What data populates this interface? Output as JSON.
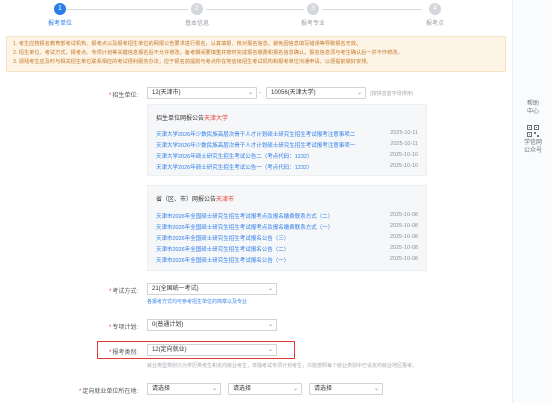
{
  "steps": [
    {
      "num": "1",
      "label": "报考单位",
      "active": true
    },
    {
      "num": "2",
      "label": "基本信息",
      "active": false
    },
    {
      "num": "3",
      "label": "报考专业",
      "active": false
    },
    {
      "num": "4",
      "label": "报考点",
      "active": false
    }
  ],
  "notice": [
    "1. 考生应按报名教育部考试机构、报考点以及报考招生单位的网报公告要求进行报名，认真填报、核对报名信息，避免因信息填写错误等导致报名无效。",
    "2. 招生单位、考试方式、报考点、专项计划等关键信息报名后不允许修改，备考期间要慎重并按时完成报名缴费和报名信息确认。报名信息须与考生确认后一并不作修改。",
    "3. 视残考生应及时与相关招生单位联系相应的考试便利服务办法，应于报名前提前与考点所在地省级招生考试机构和报考单位沟通申请，以便提前做好安排。"
  ],
  "form": {
    "unit_label": "招生单位:",
    "unit_region": "12(天津市)",
    "unit_school": "10056(天津大学)",
    "unit_hint": "(按拼音首字母排序)",
    "exam_label": "考试方式:",
    "exam_value": "21(全国统一考试)",
    "exam_hint": "各报考方式均可参考招生单位的简章以及专业",
    "plan_label": "专项计划:",
    "plan_value": "0(普通计划)",
    "category_label": "报考类别:",
    "category_value": "12(定向就业)",
    "category_hint": "就业类型类别只为学历类考生和定向就业考生，单独考试专项计划考生，只能按照每个就业类别中已设定的就业地区报考。",
    "region_label": "定向就业单位所在地:",
    "region_select1": "请选择",
    "region_select2": "请选择",
    "region_select3": "请选择"
  },
  "school_box": {
    "title": "招生单位网报公告",
    "title_red": "天津大学",
    "items": [
      {
        "text": "天津大学2026年少数民族高层次骨干人才计划硕士研究生招生考试报考注意事项二",
        "date": "2025-10-11"
      },
      {
        "text": "天津大学2026年少数民族高层次骨干人才计划硕士研究生招生考试报考注意事项一",
        "date": "2025-10-11"
      },
      {
        "text": "天津大学2026年硕士研究生招生考试公告二（考点代码：1232）",
        "date": "2025-10-10"
      },
      {
        "text": "天津大学2026年硕士研究生招生考试公告一（考点代码：1232）",
        "date": "2025-10-10"
      }
    ]
  },
  "region_box": {
    "title": "省（区、市）网报公告",
    "title_red": "天津市",
    "items": [
      {
        "text": "天津市2026年全国硕士研究生招生考试报考点及报名缴费联系方式（二）",
        "date": "2025-10-08"
      },
      {
        "text": "天津市2026年全国硕士研究生招生考试报考点及报名缴费联系方式（一）",
        "date": "2025-10-08"
      },
      {
        "text": "天津市2026年全国硕士研究生招生考试报名公告（三）",
        "date": "2025-10-08"
      },
      {
        "text": "天津市2026年全国硕士研究生招生考试报名公告（二）",
        "date": "2025-10-08"
      },
      {
        "text": "天津市2026年全国硕士研究生招生考试报名公告（一）",
        "date": "2025-10-08"
      }
    ]
  },
  "rail": {
    "help": "帮助\n中心",
    "follow": "学信网\n公众号"
  }
}
